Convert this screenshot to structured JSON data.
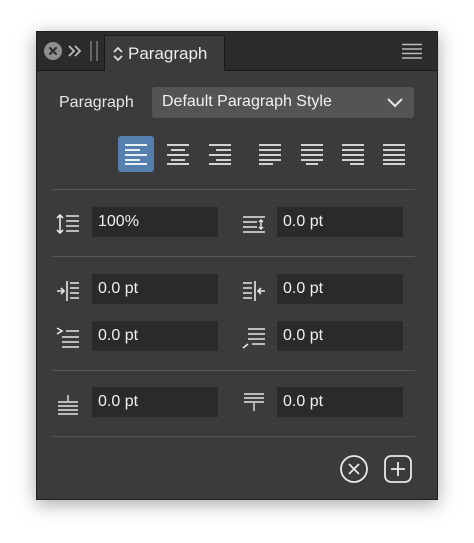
{
  "titlebar": {
    "tab_label": "Paragraph"
  },
  "style_row": {
    "label": "Paragraph",
    "selected_style": "Default Paragraph Style"
  },
  "alignment": {
    "active": "align-left",
    "buttons": [
      "align-left",
      "align-center",
      "align-right",
      "justify-left",
      "justify-center",
      "justify-right",
      "justify-all"
    ]
  },
  "spacing": {
    "leading": "100%",
    "paragraph_leading": "0.0 pt",
    "left_indent": "0.0 pt",
    "right_indent": "0.0 pt",
    "first_line_indent": "0.0 pt",
    "last_line_indent": "0.0 pt",
    "space_before": "0.0 pt",
    "space_after": "0.0 pt"
  },
  "colors": {
    "panel_bg": "#3b3b3b",
    "field_bg": "#2a2a2a",
    "accent": "#557fae"
  }
}
